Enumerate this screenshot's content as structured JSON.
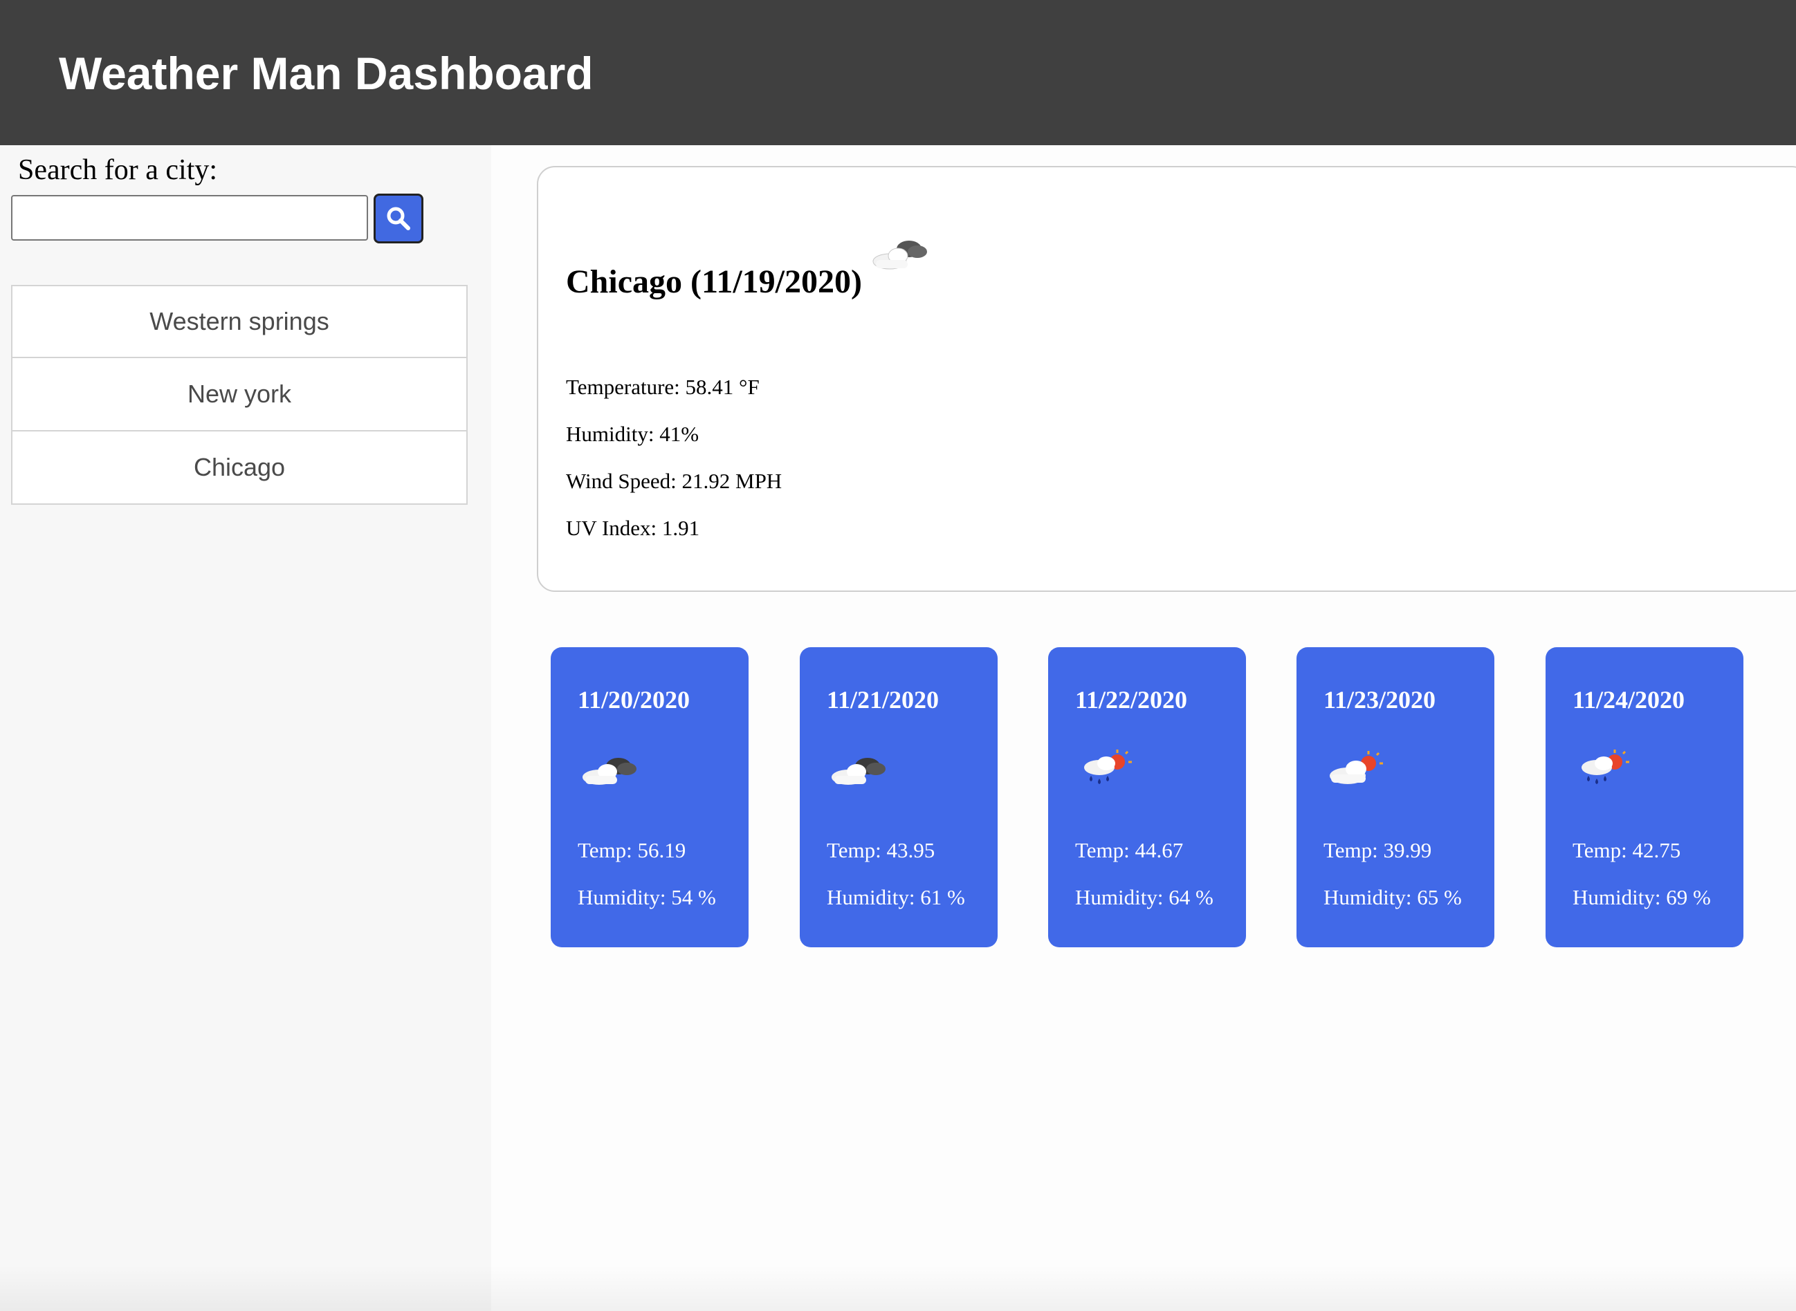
{
  "header": {
    "title": "Weather Man Dashboard"
  },
  "sidebar": {
    "search_label": "Search for a city:",
    "search_value": "",
    "search_button_icon": "search-icon",
    "cities": [
      {
        "label": "Western springs"
      },
      {
        "label": "New york"
      },
      {
        "label": "Chicago"
      }
    ]
  },
  "current": {
    "title": "Chicago (11/19/2020)",
    "icon": "cloudy-icon",
    "temperature": "Temperature: 58.41 °F",
    "humidity": "Humidity: 41%",
    "wind": "Wind Speed: 21.92 MPH",
    "uv": "UV Index: 1.91"
  },
  "forecast": [
    {
      "date": "11/20/2020",
      "icon": "cloudy-icon",
      "temp": "Temp: 56.19",
      "humidity": "Humidity: 54 %"
    },
    {
      "date": "11/21/2020",
      "icon": "cloudy-icon",
      "temp": "Temp: 43.95",
      "humidity": "Humidity: 61 %"
    },
    {
      "date": "11/22/2020",
      "icon": "rain-sun-icon",
      "temp": "Temp: 44.67",
      "humidity": "Humidity: 64 %"
    },
    {
      "date": "11/23/2020",
      "icon": "partly-cloudy-icon",
      "temp": "Temp: 39.99",
      "humidity": "Humidity: 65 %"
    },
    {
      "date": "11/24/2020",
      "icon": "rain-sun-icon",
      "temp": "Temp: 42.75",
      "humidity": "Humidity: 69 %"
    }
  ],
  "colors": {
    "header_bg": "#404040",
    "accent_blue": "#4169e8",
    "sidebar_bg": "#f7f7f7"
  }
}
